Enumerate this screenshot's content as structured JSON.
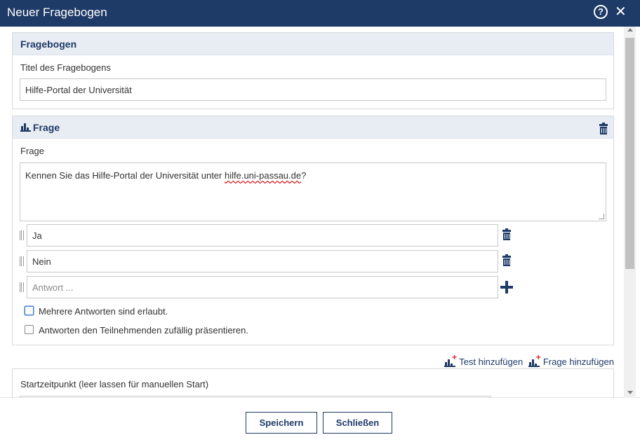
{
  "dialog": {
    "title": "Neuer Fragebogen",
    "help_icon": "question-circle-icon",
    "close_icon": "close-x-icon"
  },
  "questionnaire": {
    "heading": "Fragebogen",
    "title_label": "Titel des Fragebogens",
    "title_value": "Hilfe-Portal der Universität"
  },
  "question": {
    "heading": "Frage",
    "question_label": "Frage",
    "text_before_link": "Kennen Sie das Hilfe-Portal der Universität unter ",
    "text_link": "hilfe.uni-passau.de",
    "text_after_link": "?",
    "answers": [
      "Ja",
      "Nein"
    ],
    "new_answer_placeholder": "Antwort ...",
    "multiple_answers_label": "Mehrere Antworten sind erlaubt.",
    "random_order_label": "Antworten den Teilnehmenden zufällig präsentieren."
  },
  "actions": {
    "add_test": "Test hinzufügen",
    "add_question": "Frage hinzufügen"
  },
  "start": {
    "label": "Startzeitpunkt (leer lassen für manuellen Start)"
  },
  "footer": {
    "save": "Speichern",
    "close": "Schließen"
  }
}
